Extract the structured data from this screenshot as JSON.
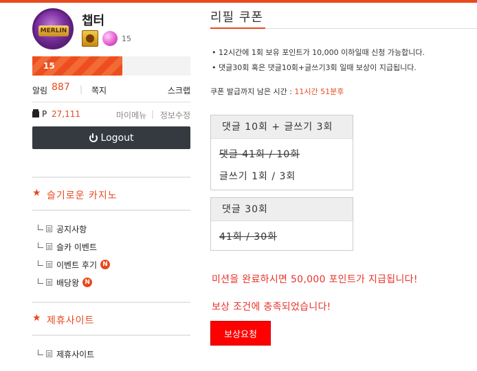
{
  "profile": {
    "username": "챕터",
    "level": "15"
  },
  "xp": {
    "label": "15",
    "progress": 0.57
  },
  "alarm": {
    "label": "알림",
    "count": "887",
    "separator": "|",
    "note_label": "쪽지",
    "scrap_label": "스크랩"
  },
  "points": {
    "prefix": "P",
    "value": "27,111",
    "my_menu": "마이메뉴",
    "separator": "|",
    "edit_info": "정보수정"
  },
  "logout_label": "Logout",
  "sidebar": {
    "section1_title": "슬기로운 카지노",
    "section1_items": [
      {
        "label": "공지사항",
        "new": ""
      },
      {
        "label": "슬카 이벤트",
        "new": ""
      },
      {
        "label": "이벤트 후기",
        "new": "N"
      },
      {
        "label": "배당왕",
        "new": "N"
      }
    ],
    "section2_title": "제휴사이트",
    "section2_items": [
      {
        "label": "제휴사이트",
        "new": ""
      }
    ]
  },
  "main": {
    "title": "리필 쿠폰",
    "notices": [
      "• 12시간에 1회 보유 포인트가 10,000 이하일때 신청 가능합니다.",
      "• 댓글30회 혹은 댓글10회+글쓰기3회 일때 보상이 지급됩니다."
    ],
    "countdown_label": "쿠폰 발급까지 남은 시간 :",
    "countdown_time": "11시간 51분후",
    "mission1": {
      "title": "댓글 10회 + 글쓰기 3회",
      "items": [
        "댓글 41회 / 10회",
        "글쓰기 1회 / 3회"
      ]
    },
    "mission2": {
      "title": "댓글 30회",
      "items": [
        "41회 / 30회"
      ]
    },
    "msg_complete": "미션을 완료하시면 50,000 포인트가 지급됩니다!",
    "msg_met": "보상 조건에 충족되었습니다!",
    "reward_button": "보상요청"
  },
  "colors": {
    "accent": "#e8491d",
    "reward_button": "#ff0000",
    "logout_bg": "#343a40"
  }
}
